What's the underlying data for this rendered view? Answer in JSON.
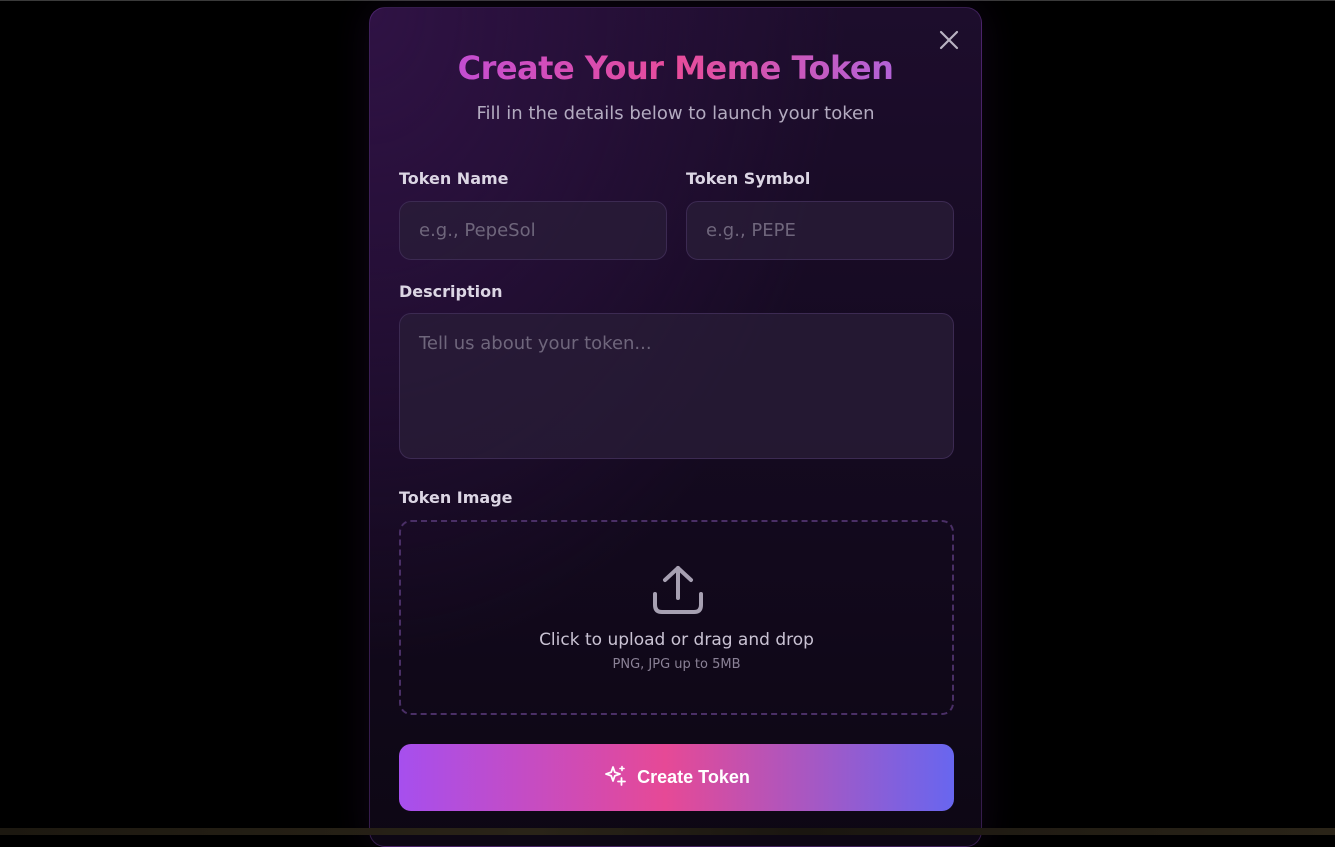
{
  "modal": {
    "title": "Create Your Meme Token",
    "subtitle": "Fill in the details below to launch your token",
    "close_icon": "close-icon"
  },
  "form": {
    "token_name": {
      "label": "Token Name",
      "value": "",
      "placeholder": "e.g., PepeSol"
    },
    "token_symbol": {
      "label": "Token Symbol",
      "value": "",
      "placeholder": "e.g., PEPE"
    },
    "description": {
      "label": "Description",
      "value": "",
      "placeholder": "Tell us about your token..."
    },
    "token_image": {
      "label": "Token Image",
      "upload_text": "Click to upload or drag and drop",
      "upload_hint": "PNG, JPG up to 5MB",
      "icon": "upload-icon"
    }
  },
  "submit": {
    "label": "Create Token",
    "icon": "sparkles-icon"
  },
  "colors": {
    "page_background": "#000000",
    "modal_background": "#150a21",
    "accent_purple": "#a64fee",
    "accent_pink": "#e64996",
    "accent_indigo": "#6866ef",
    "label_text": "#dcd6e4",
    "muted_text": "#b3abc0"
  }
}
